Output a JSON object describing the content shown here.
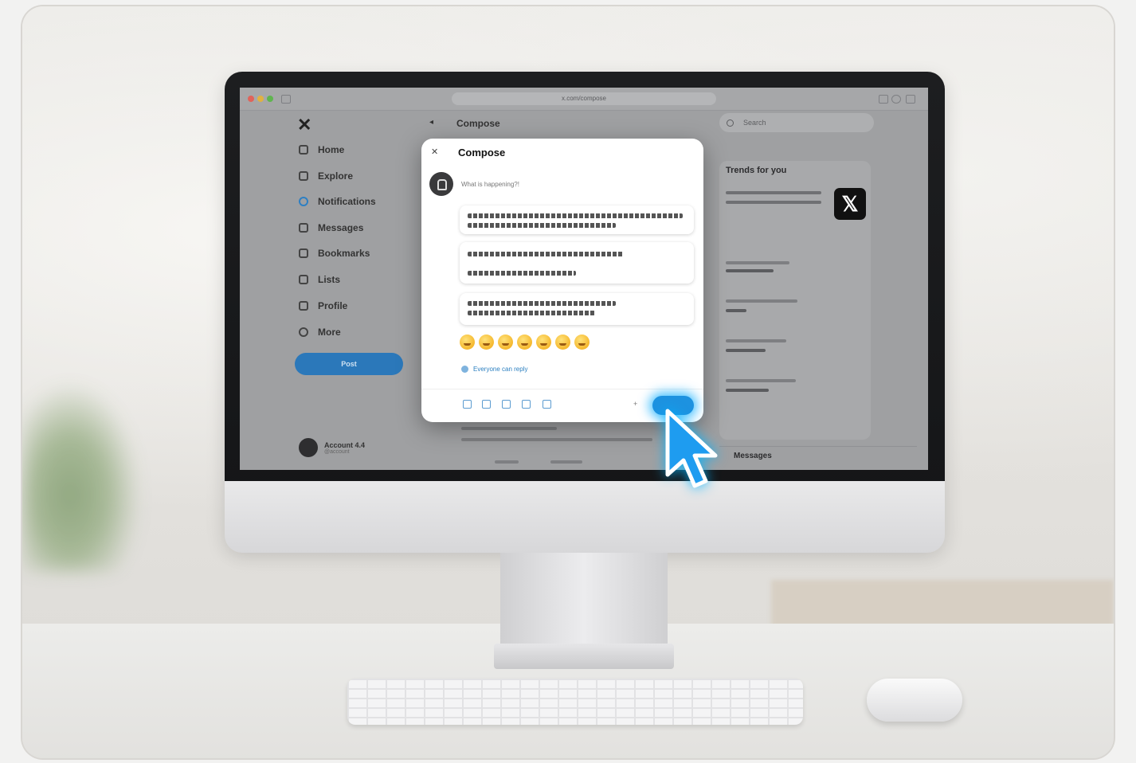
{
  "browser": {
    "url": "x.com/compose"
  },
  "sidebar": {
    "items": [
      {
        "label": "Home"
      },
      {
        "label": "Explore"
      },
      {
        "label": "Notifications"
      },
      {
        "label": "Messages"
      },
      {
        "label": "Bookmarks"
      },
      {
        "label": "Lists"
      },
      {
        "label": "Profile"
      },
      {
        "label": "More"
      }
    ],
    "post_label": "Post",
    "account": {
      "name": "Account 4.4",
      "handle": "@account"
    }
  },
  "main": {
    "back": "◂",
    "title": "Compose"
  },
  "modal": {
    "close": "✕",
    "title": "Compose",
    "placeholder": "What is happening?!",
    "reply_setting": "Everyone can reply",
    "counter": "+",
    "emojis": [
      "😀",
      "😆",
      "😂",
      "😄",
      "😊",
      "😁",
      "😅"
    ]
  },
  "right": {
    "search_placeholder": "Search",
    "trends_title": "Trends for you",
    "x_tile": "𝕏",
    "messages_label": "Messages"
  },
  "colors": {
    "accent": "#1d92e0",
    "glow": "#00b4ff"
  }
}
